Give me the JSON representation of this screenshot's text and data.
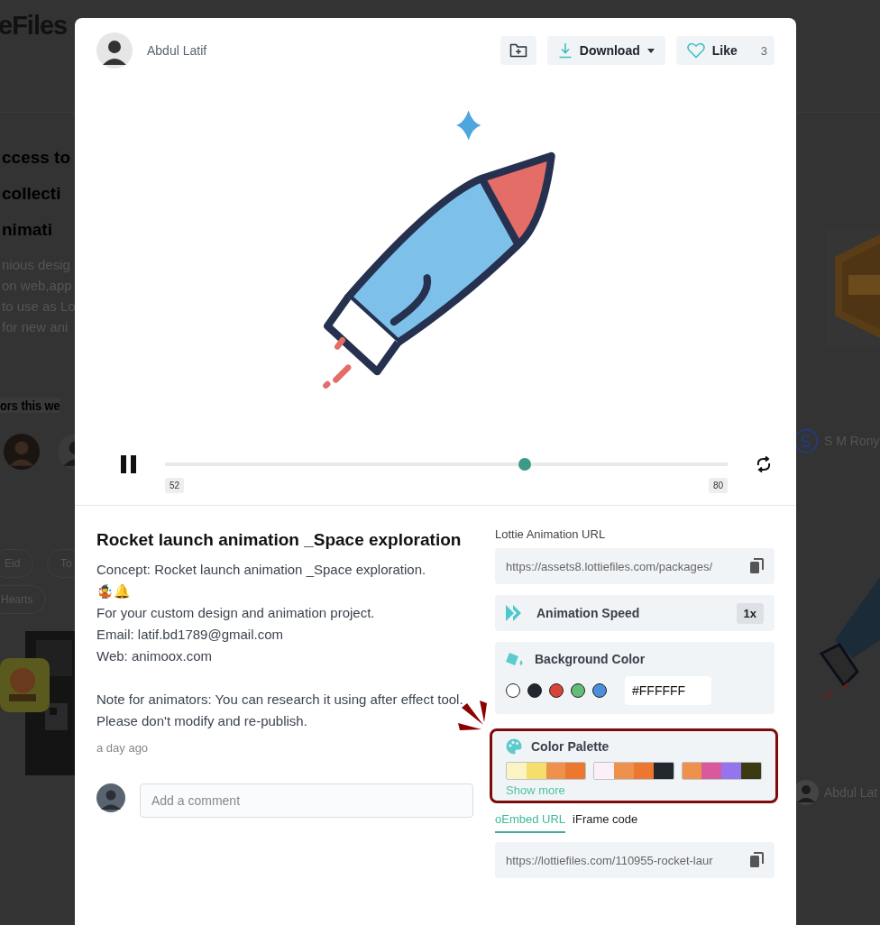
{
  "background_page": {
    "logo": "eFiles",
    "headline": [
      "ccess to",
      "collecti",
      "nimati"
    ],
    "intro": [
      "nious desig",
      "on web,app",
      "to use as Lo",
      "for new ani"
    ],
    "section_title": "ors this we",
    "tags": [
      "Eid",
      "To",
      "Hearts"
    ],
    "creators": [
      "S M Rony",
      "Abdul Lat"
    ]
  },
  "modal": {
    "author": "Abdul Latif",
    "download": "Download",
    "like": "Like",
    "like_count": "3",
    "player": {
      "playing": true,
      "level": 0.64,
      "start": "52",
      "end": "80"
    },
    "title": "Rocket launch animation _Space exploration",
    "description": [
      "Concept: Rocket launch animation _Space exploration.",
      "🤹🔔",
      "For your custom design and animation project.",
      "Email: latif.bd1789@gmail.com",
      "Web: animoox.com"
    ],
    "note": "Note for animators: You can research it using after effect tool. Please don't modify and re-publish.",
    "time": "a day ago",
    "comment": {
      "placeholder": "Add a comment"
    },
    "lottie_url": {
      "label": "Lottie Animation URL",
      "value": "https://assets8.lottiefiles.com/packages/"
    },
    "speed": {
      "label": "Animation Speed",
      "value": "1x"
    },
    "background_color": {
      "label": "Background Color",
      "value": "#FFFFFF",
      "swatches": [
        {
          "color": "#ffffff"
        },
        {
          "color": "#22262e"
        },
        {
          "color": "#d6453a"
        },
        {
          "color": "#62bd78"
        },
        {
          "color": "#4a8fdc"
        }
      ]
    },
    "color_palette": {
      "label": "Color Palette",
      "highlighted": true,
      "link": "Show more",
      "palettes": [
        {
          "swatches": [
            {
              "color": "#fcf3c4"
            },
            {
              "color": "#f3df6a"
            },
            {
              "color": "#ee914c"
            },
            {
              "color": "#eb7731"
            }
          ]
        },
        {
          "swatches": [
            {
              "color": "#fcf0f7"
            },
            {
              "color": "#ee914c"
            },
            {
              "color": "#eb7731"
            },
            {
              "color": "#23272e"
            }
          ]
        },
        {
          "swatches": [
            {
              "color": "#ee914c"
            },
            {
              "color": "#d9599c"
            },
            {
              "color": "#9575ee"
            },
            {
              "color": "#3b3a12"
            }
          ]
        }
      ]
    },
    "embed_tabs": [
      {
        "label": "oEmbed URL",
        "selected": true
      },
      {
        "label": "iFrame code",
        "selected": false
      }
    ],
    "embed_value": "https://lottiefiles.com/110955-rocket-laur"
  }
}
